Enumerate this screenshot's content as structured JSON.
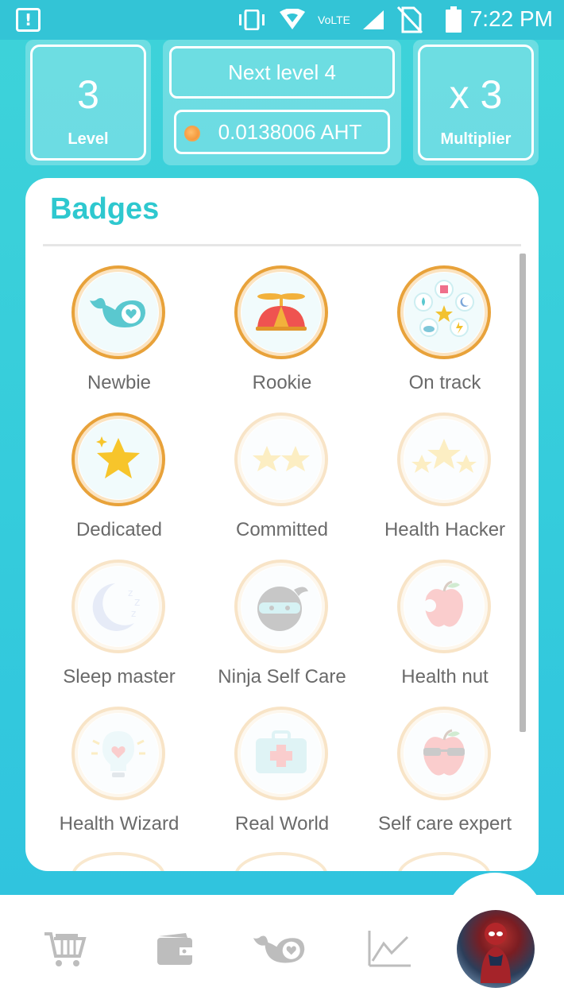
{
  "status_bar": {
    "network_label": "VoLTE",
    "time": "7:22 PM"
  },
  "stats": {
    "level_value": "3",
    "level_label": "Level",
    "next_level": "Next level 4",
    "balance": "0.0138006 AHT",
    "multiplier_value": "x 3",
    "multiplier_label": "Multiplier"
  },
  "badges_card": {
    "title": "Badges",
    "items": [
      {
        "label": "Newbie",
        "icon": "whale-heart-icon",
        "earned": true
      },
      {
        "label": "Rookie",
        "icon": "propeller-cap-icon",
        "earned": true
      },
      {
        "label": "On track",
        "icon": "health-wheel-icon",
        "earned": true
      },
      {
        "label": "Dedicated",
        "icon": "star-icon",
        "earned": true
      },
      {
        "label": "Committed",
        "icon": "two-stars-icon",
        "earned": false
      },
      {
        "label": "Health Hacker",
        "icon": "three-stars-icon",
        "earned": false
      },
      {
        "label": "Sleep master",
        "icon": "moon-zzz-icon",
        "earned": false
      },
      {
        "label": "Ninja Self Care",
        "icon": "ninja-icon",
        "earned": false
      },
      {
        "label": "Health nut",
        "icon": "apple-bite-icon",
        "earned": false
      },
      {
        "label": "Health Wizard",
        "icon": "lightbulb-heart-icon",
        "earned": false
      },
      {
        "label": "Real World",
        "icon": "first-aid-kit-icon",
        "earned": false
      },
      {
        "label": "Self care expert",
        "icon": "cool-apple-icon",
        "earned": false
      }
    ]
  },
  "bottom_nav": {
    "items": [
      "cart-icon",
      "wallet-icon",
      "whale-heart-icon",
      "chart-icon",
      "profile-avatar"
    ]
  },
  "colors": {
    "accent": "#2ec8cf",
    "badge_ring": "#e8a23a",
    "nav_icon": "#bdbdbd"
  }
}
